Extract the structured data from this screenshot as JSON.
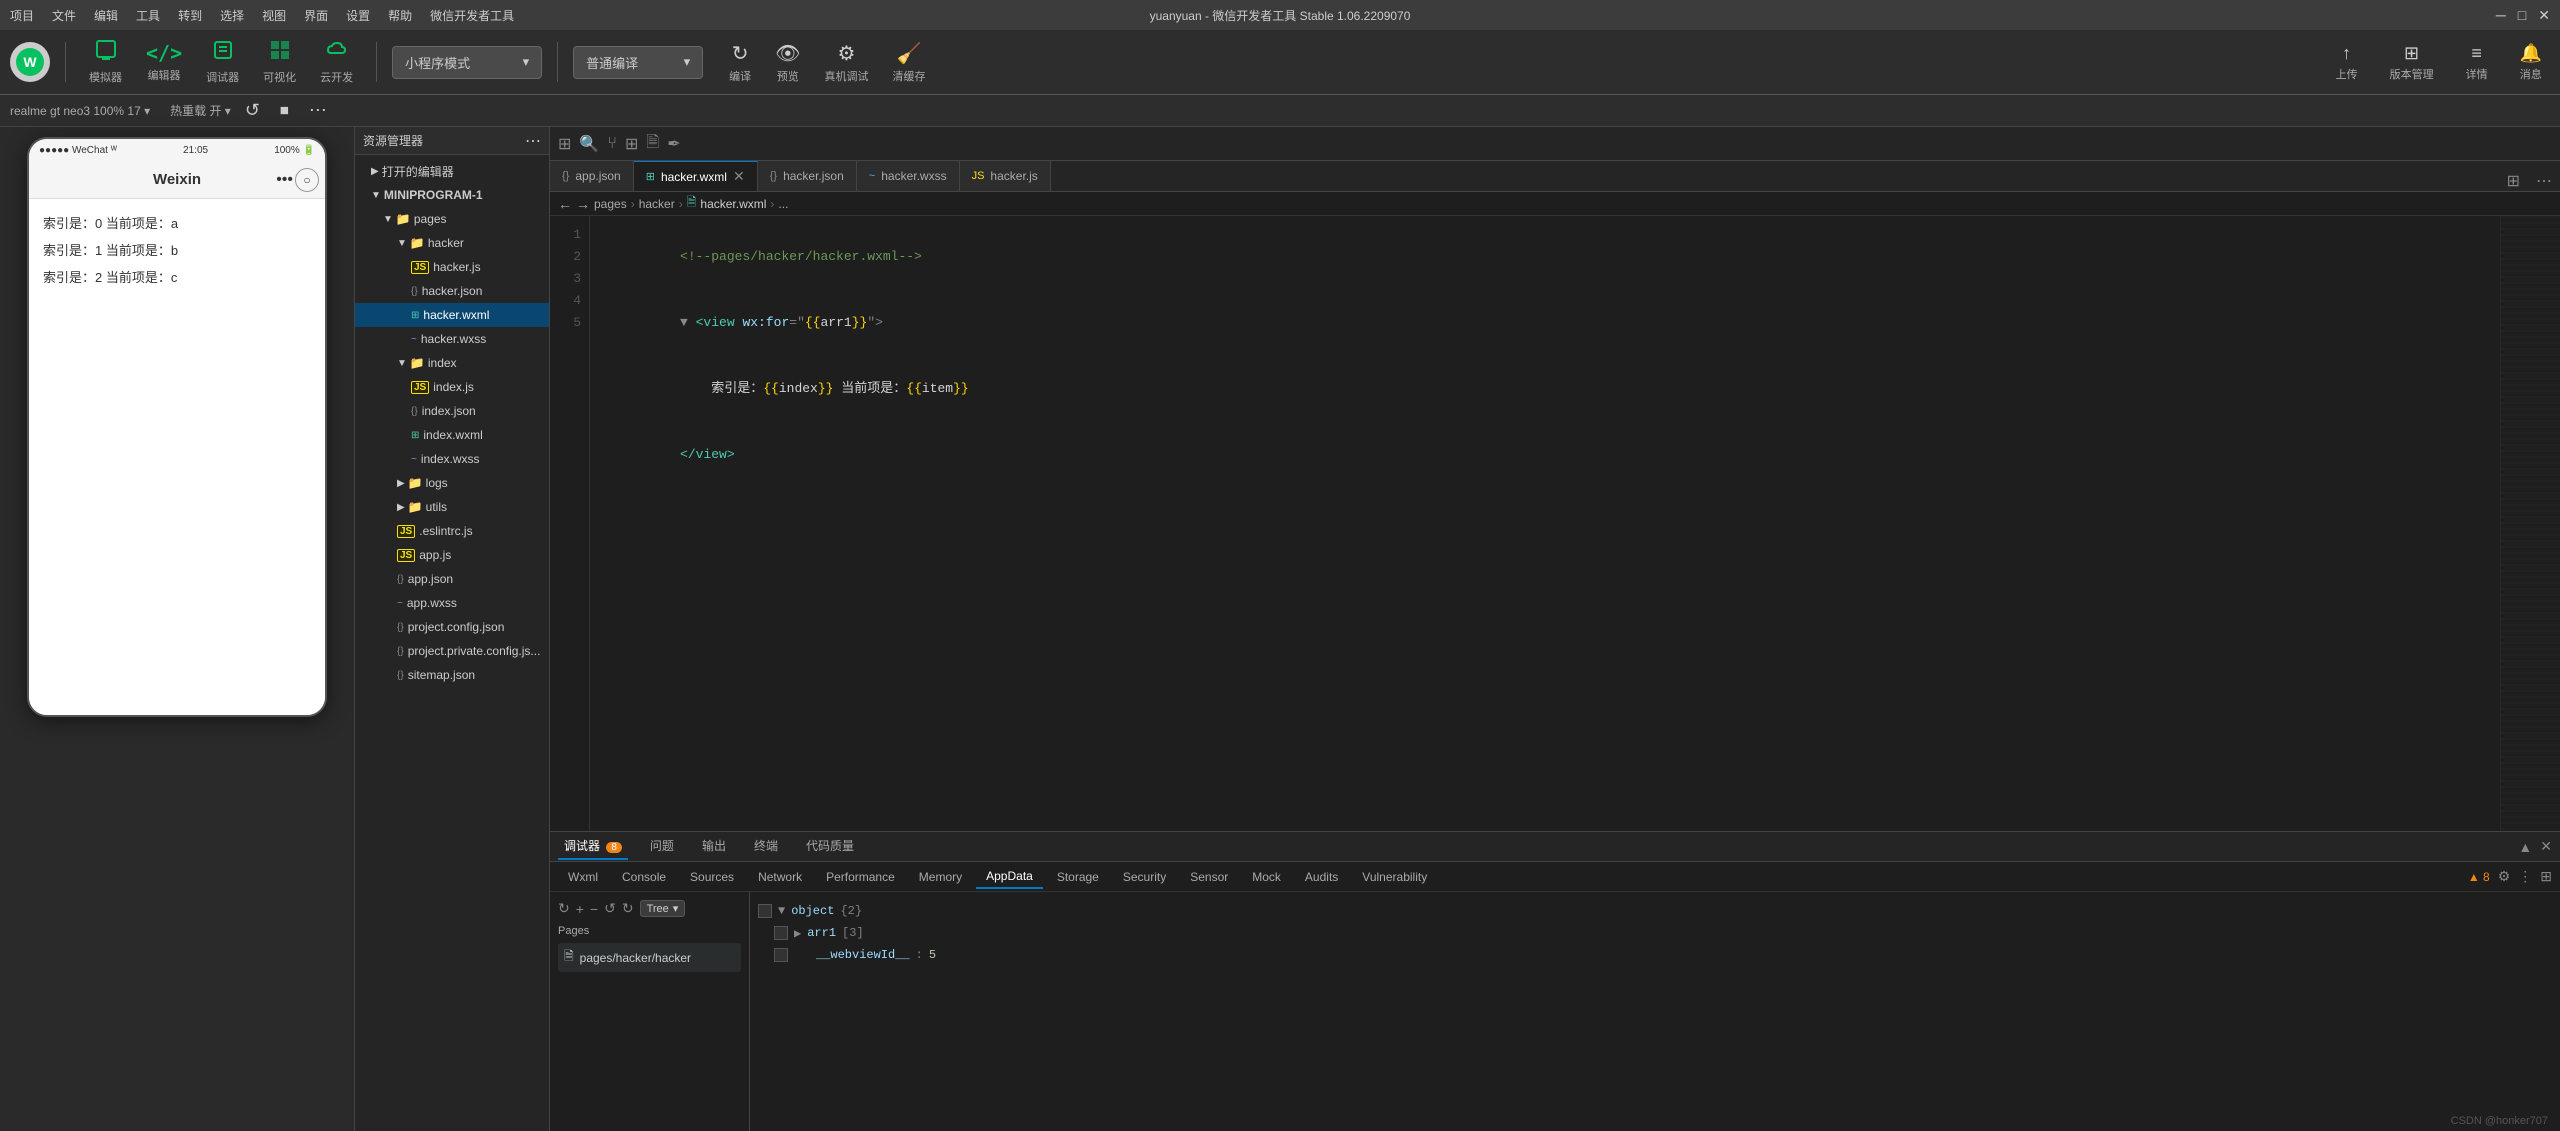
{
  "titlebar": {
    "menu_items": [
      "项目",
      "文件",
      "编辑",
      "工具",
      "转到",
      "选择",
      "视图",
      "界面",
      "设置",
      "帮助",
      "微信开发者工具"
    ],
    "title": "yuanyuan - 微信开发者工具 Stable 1.06.2209070",
    "controls": [
      "─",
      "□",
      "✕"
    ]
  },
  "toolbar": {
    "logo_text": "W",
    "buttons": [
      {
        "icon": "▣",
        "label": "模拟器"
      },
      {
        "icon": "</>",
        "label": "编辑器"
      },
      {
        "icon": "⚙",
        "label": "调试器"
      },
      {
        "icon": "⊞",
        "label": "可视化"
      },
      {
        "icon": "☁",
        "label": "云开发"
      }
    ],
    "mode_selector": "小程序模式",
    "compile_btn": "普通编译",
    "action_btns": [
      {
        "icon": "↻",
        "label": "编译"
      },
      {
        "icon": "👁",
        "label": "预览"
      },
      {
        "icon": "⚙",
        "label": "真机调试"
      },
      {
        "icon": "🧹",
        "label": "清缓存"
      }
    ],
    "right_btns": [
      {
        "icon": "↑",
        "label": "上传"
      },
      {
        "icon": "⊞",
        "label": "版本管理"
      },
      {
        "icon": "≡",
        "label": "详情"
      },
      {
        "icon": "🔔",
        "label": "消息"
      }
    ]
  },
  "secondary_toolbar": {
    "device": "realme gt neo3 100% 17 ▾",
    "hotreload": "热重载 开 ▾",
    "controls": [
      "↺",
      "⏹",
      "⋯"
    ]
  },
  "simulator": {
    "status_bar": {
      "left": "●●●●● WeChat ᵂ",
      "center": "21:05",
      "right": "100% 🔋"
    },
    "nav_title": "Weixin",
    "content_lines": [
      "索引是：0 当前项是：a",
      "索引是：1 当前项是：b",
      "索引是：2 当前项是：c"
    ]
  },
  "filetree": {
    "header": "资源管理器",
    "section_open": "打开的编辑器",
    "project_name": "MINIPROGRAM-1",
    "items": [
      {
        "type": "folder",
        "name": "pages",
        "level": 2,
        "expanded": true
      },
      {
        "type": "folder",
        "name": "hacker",
        "level": 3,
        "expanded": true
      },
      {
        "type": "file",
        "name": "hacker.js",
        "level": 4,
        "ext": "js"
      },
      {
        "type": "file",
        "name": "hacker.json",
        "level": 4,
        "ext": "json"
      },
      {
        "type": "file",
        "name": "hacker.wxml",
        "level": 4,
        "ext": "wxml",
        "active": true
      },
      {
        "type": "file",
        "name": "hacker.wxss",
        "level": 4,
        "ext": "wxss"
      },
      {
        "type": "folder",
        "name": "index",
        "level": 3,
        "expanded": true
      },
      {
        "type": "file",
        "name": "index.js",
        "level": 4,
        "ext": "js"
      },
      {
        "type": "file",
        "name": "index.json",
        "level": 4,
        "ext": "json"
      },
      {
        "type": "file",
        "name": "index.wxml",
        "level": 4,
        "ext": "wxml"
      },
      {
        "type": "file",
        "name": "index.wxss",
        "level": 4,
        "ext": "wxss"
      },
      {
        "type": "folder",
        "name": "logs",
        "level": 3,
        "expanded": false
      },
      {
        "type": "folder",
        "name": "utils",
        "level": 3,
        "expanded": false
      },
      {
        "type": "file",
        "name": ".eslintrc.js",
        "level": 3,
        "ext": "js"
      },
      {
        "type": "file",
        "name": "app.js",
        "level": 3,
        "ext": "js"
      },
      {
        "type": "file",
        "name": "app.json",
        "level": 3,
        "ext": "json"
      },
      {
        "type": "file",
        "name": "app.wxss",
        "level": 3,
        "ext": "wxss"
      },
      {
        "type": "file",
        "name": "project.config.json",
        "level": 3,
        "ext": "json"
      },
      {
        "type": "file",
        "name": "project.private.config.js...",
        "level": 3,
        "ext": "json"
      },
      {
        "type": "file",
        "name": "sitemap.json",
        "level": 3,
        "ext": "json"
      }
    ]
  },
  "editor": {
    "tabs": [
      {
        "name": "app.json",
        "ext": "json",
        "active": false
      },
      {
        "name": "hacker.wxml",
        "ext": "wxml",
        "active": true
      },
      {
        "name": "hacker.json",
        "ext": "json",
        "active": false
      },
      {
        "name": "hacker.wxss",
        "ext": "wxss",
        "active": false
      },
      {
        "name": "hacker.js",
        "ext": "js",
        "active": false
      }
    ],
    "breadcrumb": [
      "pages",
      ">",
      "hacker",
      ">",
      "🗎 hacker.wxml",
      ">",
      "..."
    ],
    "code_lines": [
      {
        "num": 1,
        "content": "<!--pages/hacker/hacker.wxml-->",
        "type": "comment"
      },
      {
        "num": 2,
        "content": "<view wx:for=\"{{arr1}}\">",
        "type": "code"
      },
      {
        "num": 3,
        "content": "    索引是：{{index}} 当前项是：{{item}}",
        "type": "code"
      },
      {
        "num": 4,
        "content": "</view>",
        "type": "code"
      },
      {
        "num": 5,
        "content": "",
        "type": "empty"
      }
    ]
  },
  "debug": {
    "tabs": [
      {
        "name": "调试器",
        "badge": "8",
        "active": false
      },
      {
        "name": "问题",
        "active": false
      },
      {
        "name": "输出",
        "active": false
      },
      {
        "name": "终端",
        "active": false
      },
      {
        "name": "代码质量",
        "active": false
      }
    ],
    "panel_tabs": [
      {
        "name": "Wxml",
        "active": false
      },
      {
        "name": "Console",
        "active": false
      },
      {
        "name": "Sources",
        "active": false
      },
      {
        "name": "Network",
        "active": false
      },
      {
        "name": "Performance",
        "active": false
      },
      {
        "name": "Memory",
        "active": false
      },
      {
        "name": "AppData",
        "active": true
      },
      {
        "name": "Storage",
        "active": false
      },
      {
        "name": "Security",
        "active": false
      },
      {
        "name": "Sensor",
        "active": false
      },
      {
        "name": "Mock",
        "active": false
      },
      {
        "name": "Audits",
        "active": false
      },
      {
        "name": "Vulnerability",
        "active": false
      }
    ],
    "pages_label": "Pages",
    "pages_items": [
      "pages/hacker/hacker"
    ],
    "appdata": {
      "tree": [
        {
          "label": "▼ object {2}",
          "level": 0
        },
        {
          "label": "▶ arr1 [3]",
          "level": 1
        },
        {
          "label": "__webviewId__ : 5",
          "level": 1
        }
      ]
    },
    "warning_count": "▲ 8"
  },
  "credit": "CSDN @honker707"
}
